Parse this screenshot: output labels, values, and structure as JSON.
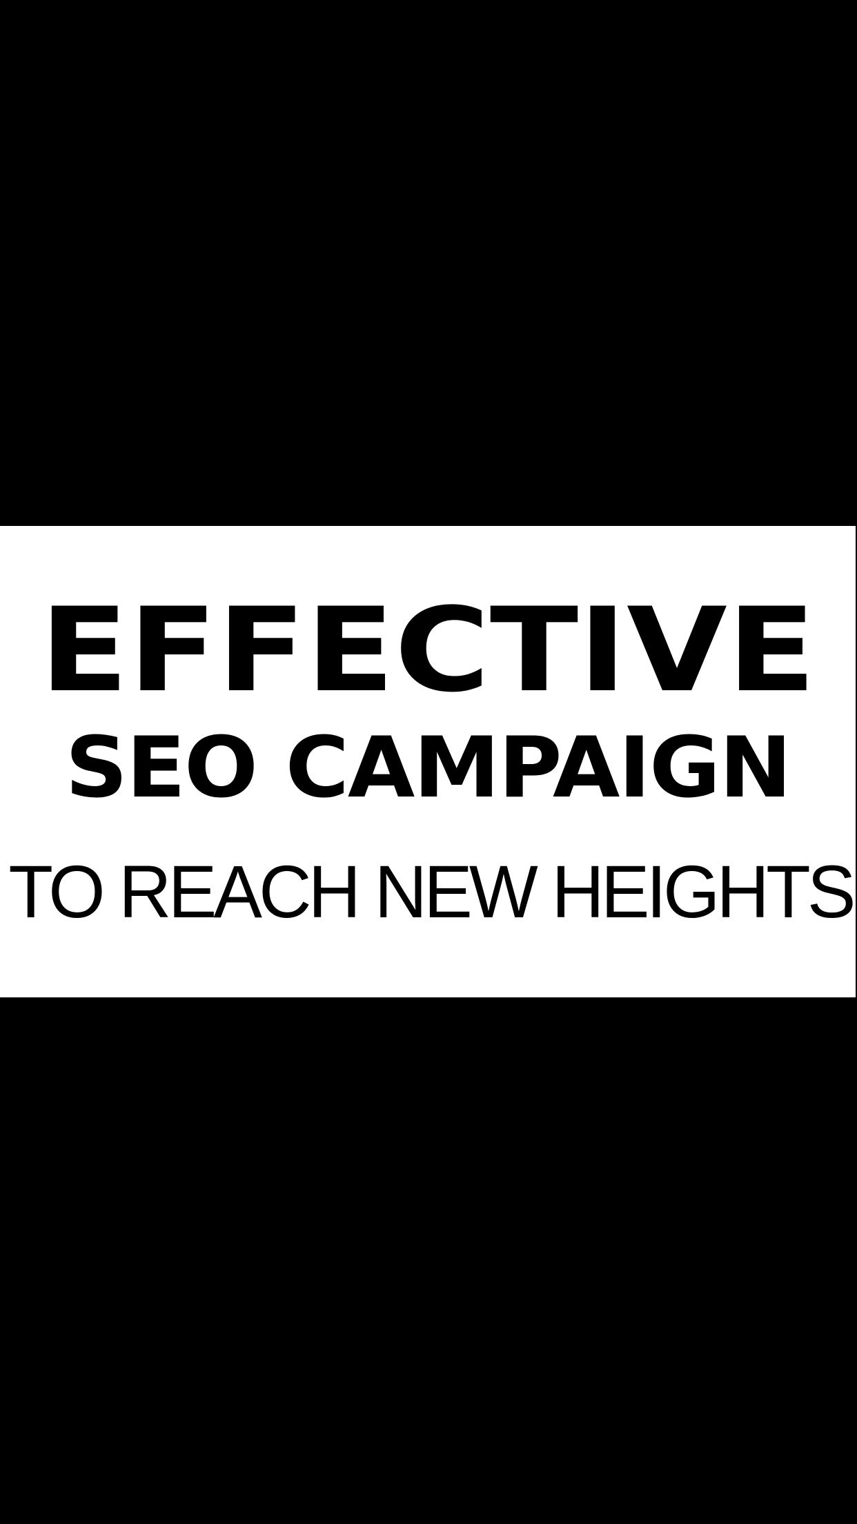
{
  "viewer": {
    "background_color": "#000000"
  },
  "image": {
    "background_color": "#ffffff",
    "text_color": "#000000",
    "headline_line_1": "EFFECTIVE",
    "headline_line_2": "SEO CAMPAIGN",
    "headline_line_3": "TO REACH NEW HEIGHTS"
  }
}
